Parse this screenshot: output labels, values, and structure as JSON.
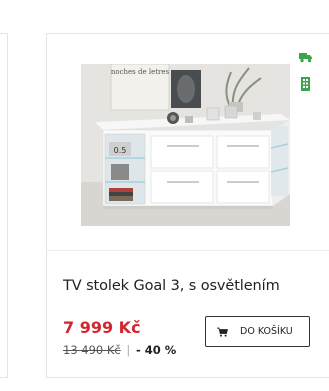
{
  "product": {
    "image_alt": "TV stolek Goal 3 – white lowboard with LED lighting",
    "image_wall_text": "noches de letres",
    "image_book_label": "0.5",
    "title": "TV stolek Goal 3, s osvětlením",
    "price_current": "7 999 Kč",
    "price_old": "13 490 Kč",
    "price_separator": "|",
    "discount": "- 40 %",
    "cart_button_label": "DO KOŠÍKU"
  },
  "availability_icons": [
    "truck-icon",
    "store-icon"
  ],
  "colors": {
    "accent_red": "#d2262f",
    "availability_green": "#3fa34d",
    "border": "#e4e4e4"
  }
}
